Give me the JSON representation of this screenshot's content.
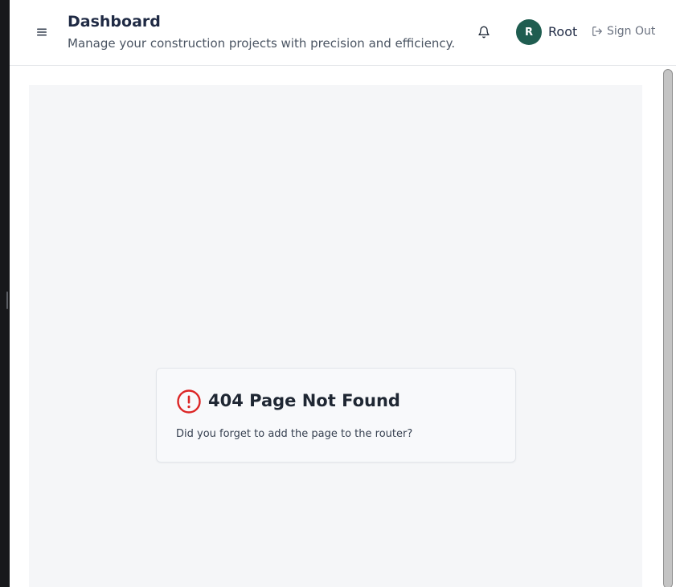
{
  "header": {
    "title": "Dashboard",
    "subtitle": "Manage your construction projects with precision and efficiency.",
    "menu_icon": "hamburger-menu-icon",
    "notification_icon": "bell-icon"
  },
  "user": {
    "avatar_initial": "R",
    "name": "Root",
    "avatar_color": "#1f5d50"
  },
  "signout": {
    "label": "Sign Out",
    "icon": "sign-out-icon"
  },
  "error": {
    "title": "404 Page Not Found",
    "message": "Did you forget to add the page to the router?",
    "icon": "alert-circle-icon",
    "accent_color": "#dc2626"
  }
}
